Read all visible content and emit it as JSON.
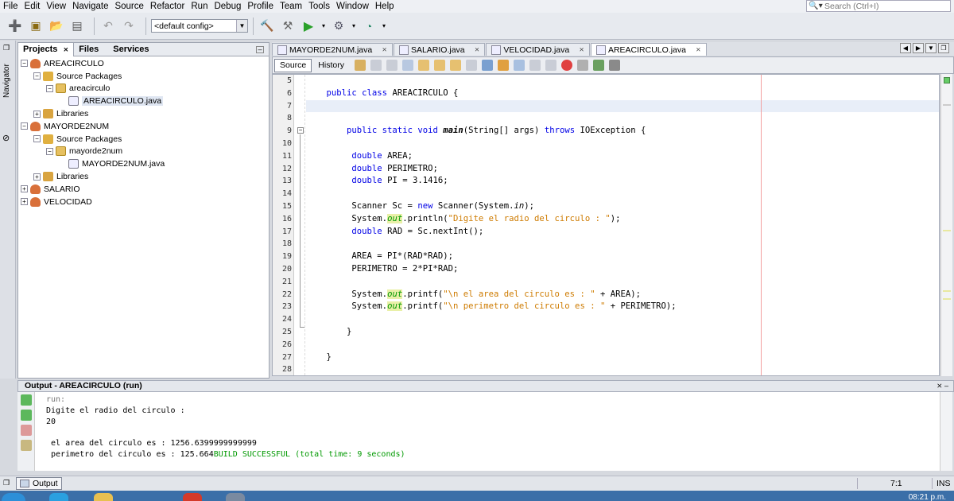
{
  "menu": [
    "File",
    "Edit",
    "View",
    "Navigate",
    "Source",
    "Refactor",
    "Run",
    "Debug",
    "Profile",
    "Team",
    "Tools",
    "Window",
    "Help"
  ],
  "search": {
    "placeholder": "Search (Ctrl+I)",
    "icon": "search-icon"
  },
  "toolbar": {
    "config": "<default config>"
  },
  "navigator_label": "Navigator",
  "projects_panel": {
    "tabs": [
      "Projects",
      "Files",
      "Services"
    ],
    "tree": [
      {
        "label": "AREACIRCULO",
        "type": "project",
        "depth": 0,
        "expanded": true
      },
      {
        "label": "Source Packages",
        "type": "source-packages",
        "depth": 1,
        "expanded": true
      },
      {
        "label": "areacirculo",
        "type": "package",
        "depth": 2,
        "expanded": true
      },
      {
        "label": "AREACIRCULO.java",
        "type": "java-file",
        "depth": 3,
        "selected": true
      },
      {
        "label": "Libraries",
        "type": "libraries",
        "depth": 1,
        "expanded": false
      },
      {
        "label": "MAYORDE2NUM",
        "type": "project",
        "depth": 0,
        "expanded": true
      },
      {
        "label": "Source Packages",
        "type": "source-packages",
        "depth": 1,
        "expanded": true
      },
      {
        "label": "mayorde2num",
        "type": "package",
        "depth": 2,
        "expanded": true
      },
      {
        "label": "MAYORDE2NUM.java",
        "type": "java-file",
        "depth": 3
      },
      {
        "label": "Libraries",
        "type": "libraries",
        "depth": 1,
        "expanded": false
      },
      {
        "label": "SALARIO",
        "type": "project",
        "depth": 0,
        "expanded": false
      },
      {
        "label": "VELOCIDAD",
        "type": "project",
        "depth": 0,
        "expanded": false
      }
    ]
  },
  "editor": {
    "tabs": [
      {
        "label": "MAYORDE2NUM.java",
        "active": false
      },
      {
        "label": "SALARIO.java",
        "active": false
      },
      {
        "label": "VELOCIDAD.java",
        "active": false
      },
      {
        "label": "AREACIRCULO.java",
        "active": true
      }
    ],
    "source_label": "Source",
    "history_label": "History",
    "lines": [
      {
        "n": "5",
        "code": []
      },
      {
        "n": "6",
        "code": [
          [
            "    ",
            ""
          ],
          [
            "public class",
            "kw"
          ],
          [
            " AREACIRCULO {",
            ""
          ]
        ]
      },
      {
        "n": "7",
        "code": []
      },
      {
        "n": "8",
        "code": []
      },
      {
        "n": "9",
        "code": [
          [
            "        ",
            ""
          ],
          [
            "public static void",
            "kw"
          ],
          [
            " ",
            ""
          ],
          [
            "main",
            "mth"
          ],
          [
            "(String[] args) ",
            ""
          ],
          [
            "throws",
            "kw"
          ],
          [
            " IOException {",
            ""
          ]
        ]
      },
      {
        "n": "10",
        "code": []
      },
      {
        "n": "11",
        "code": [
          [
            "         ",
            ""
          ],
          [
            "double",
            "kw"
          ],
          [
            " AREA;",
            ""
          ]
        ]
      },
      {
        "n": "12",
        "code": [
          [
            "         ",
            ""
          ],
          [
            "double",
            "kw"
          ],
          [
            " PERIMETRO;",
            ""
          ]
        ]
      },
      {
        "n": "13",
        "code": [
          [
            "         ",
            ""
          ],
          [
            "double",
            "kw"
          ],
          [
            " PI = 3.1416;",
            ""
          ]
        ]
      },
      {
        "n": "14",
        "code": []
      },
      {
        "n": "15",
        "code": [
          [
            "         Scanner Sc = ",
            ""
          ],
          [
            "new",
            "kw"
          ],
          [
            " Scanner(System.",
            ""
          ],
          [
            "in",
            "stat"
          ],
          [
            ");",
            ""
          ]
        ]
      },
      {
        "n": "16",
        "code": [
          [
            "         System.",
            ""
          ],
          [
            "out",
            "fld"
          ],
          [
            ".println(",
            ""
          ],
          [
            "\"Digite el radio del circulo : \"",
            "str"
          ],
          [
            ");",
            ""
          ]
        ]
      },
      {
        "n": "17",
        "code": [
          [
            "         ",
            ""
          ],
          [
            "double",
            "kw"
          ],
          [
            " RAD = Sc.nextInt();",
            ""
          ]
        ]
      },
      {
        "n": "18",
        "code": []
      },
      {
        "n": "19",
        "code": [
          [
            "         AREA = PI*(RAD*RAD);",
            ""
          ]
        ]
      },
      {
        "n": "20",
        "code": [
          [
            "         PERIMETRO = 2*PI*RAD;",
            ""
          ]
        ]
      },
      {
        "n": "21",
        "code": []
      },
      {
        "n": "22",
        "code": [
          [
            "         System.",
            ""
          ],
          [
            "out",
            "fld"
          ],
          [
            ".printf(",
            ""
          ],
          [
            "\"\\n el area del circulo es : \"",
            "str"
          ],
          [
            " + AREA);",
            ""
          ]
        ]
      },
      {
        "n": "23",
        "code": [
          [
            "         System.",
            ""
          ],
          [
            "out",
            "fld"
          ],
          [
            ".printf(",
            ""
          ],
          [
            "\"\\n perimetro del circulo es : \"",
            "str"
          ],
          [
            " + PERIMETRO);",
            ""
          ]
        ]
      },
      {
        "n": "24",
        "code": []
      },
      {
        "n": "25",
        "code": [
          [
            "        }",
            ""
          ]
        ]
      },
      {
        "n": "26",
        "code": []
      },
      {
        "n": "27",
        "code": [
          [
            "    }",
            ""
          ]
        ]
      },
      {
        "n": "28",
        "code": []
      }
    ]
  },
  "output": {
    "title": "Output - AREACIRCULO (run)",
    "lines": [
      {
        "text": "run:",
        "cls": "gray"
      },
      {
        "text": "Digite el radio del circulo :",
        "cls": ""
      },
      {
        "text": "20",
        "cls": ""
      },
      {
        "text": "",
        "cls": ""
      },
      {
        "text": " el area del circulo es : 1256.6399999999999",
        "cls": ""
      },
      {
        "text": " perimetro del circulo es : 125.664",
        "cls": "",
        "tail": "BUILD SUCCESSFUL (total time: 9 seconds)"
      }
    ]
  },
  "status": {
    "tab_label": "Output",
    "position": "7:1",
    "mode": "INS"
  },
  "taskbar": {
    "clock": "08:21 p.m."
  }
}
